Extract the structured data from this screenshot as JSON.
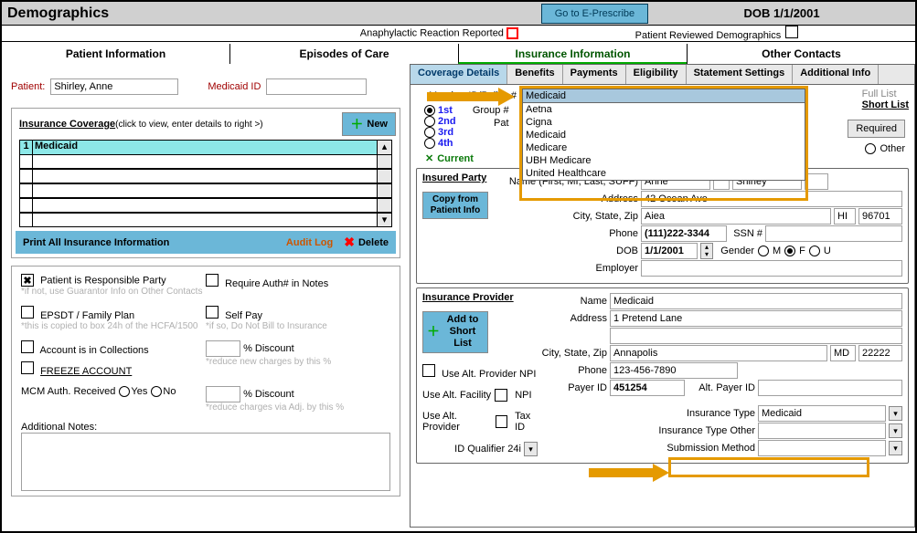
{
  "header": {
    "title": "Demographics",
    "eprescribe": "Go to E-Prescribe",
    "dob": "DOB 1/1/2001",
    "anaphylactic": "Anaphylactic Reaction Reported",
    "reviewed": "Patient Reviewed Demographics"
  },
  "mainTabs": {
    "t1": "Patient Information",
    "t2": "Episodes of Care",
    "t3": "Insurance Information",
    "t4": "Other Contacts"
  },
  "patient": {
    "label": "Patient:",
    "name": "Shirley, Anne",
    "medicaid_label": "Medicaid ID",
    "medicaid_id": ""
  },
  "insCov": {
    "title": "Insurance Coverage",
    "hint": "(click to view, enter details to right >)",
    "new": "New",
    "row1_num": "1",
    "row1_txt": "Medicaid",
    "print": "Print All Insurance Information",
    "audit": "Audit Log",
    "delete": "Delete"
  },
  "opts": {
    "resp": "Patient is Responsible Party",
    "resp_h": "*if not, use Guarantor Info on Other Contacts",
    "auth": "Require Auth# in Notes",
    "epsdt": "EPSDT / Family Plan",
    "epsdt_h": "*this is copied to box 24h of the HCFA/1500",
    "selfpay": "Self Pay",
    "selfpay_h": "*if so, Do Not Bill to Insurance",
    "collections": "Account is in Collections",
    "freeze": "FREEZE ACCOUNT",
    "disc1": "% Discount",
    "disc1_h": "*reduce new charges by this %",
    "mcm": "MCM Auth. Received",
    "yes": "Yes",
    "no": "No",
    "disc2": "% Discount",
    "disc2_h": "*reduce charges via Adj. by this %",
    "notes": "Additional Notes:"
  },
  "rtabs": {
    "t1": "Coverage Details",
    "t2": "Benefits",
    "t3": "Payments",
    "t4": "Eligibility",
    "t5": "Statement Settings",
    "t6": "Additional Info"
  },
  "cov": {
    "member": "Member ID/Policy #",
    "group": "Group #",
    "pat": "Pat",
    "o1": "1st",
    "o2": "2nd",
    "o3": "3rd",
    "o4": "4th",
    "current": "Current",
    "full": "Full List",
    "short": "Short List",
    "required": "Required",
    "other": "Other"
  },
  "dd": {
    "selected": "Medicaid",
    "items": [
      "Aetna",
      "Cigna",
      "Medicaid",
      "Medicare",
      "UBH Medicare",
      "United Healthcare"
    ]
  },
  "ip": {
    "title": "Insured Party",
    "copy": "Copy from Patient Info",
    "name_l": "Name (First, MI, Last, SUFF)",
    "first": "Anne",
    "mi": "",
    "last": "Shirley",
    "suff": "",
    "addr_l": "Address",
    "addr": "42 Ocean Ave",
    "csz_l": "City, State, Zip",
    "city": "Aiea",
    "st": "HI",
    "zip": "96701",
    "phone_l": "Phone",
    "phone": "(111)222-3344",
    "ssn_l": "SSN #",
    "ssn": "",
    "dob_l": "DOB",
    "dob": "1/1/2001",
    "gender_l": "Gender",
    "m": "M",
    "f": "F",
    "u": "U",
    "emp_l": "Employer",
    "emp": ""
  },
  "prov": {
    "title": "Insurance Provider",
    "add": "Add to Short List",
    "name_l": "Name",
    "name": "Medicaid",
    "addr_l": "Address",
    "addr": "1 Pretend Lane",
    "csz_l": "City, State, Zip",
    "city": "Annapolis",
    "st": "MD",
    "zip": "22222",
    "phone_l": "Phone",
    "phone": "123-456-7890",
    "payer_l": "Payer ID",
    "payer": "451254",
    "alt_payer_l": "Alt. Payer ID",
    "alt_payer": "",
    "alt_npi": "Use Alt. Provider NPI",
    "alt_fac": "Use Alt. Facility",
    "npi": "NPI",
    "alt_prov": "Use Alt. Provider",
    "tax": "Tax ID",
    "itype_l": "Insurance Type",
    "itype": "Medicaid",
    "itype_o_l": "Insurance Type Other",
    "itype_o": "",
    "idq": "ID Qualifier 24i",
    "sub_l": "Submission Method",
    "sub": ""
  }
}
